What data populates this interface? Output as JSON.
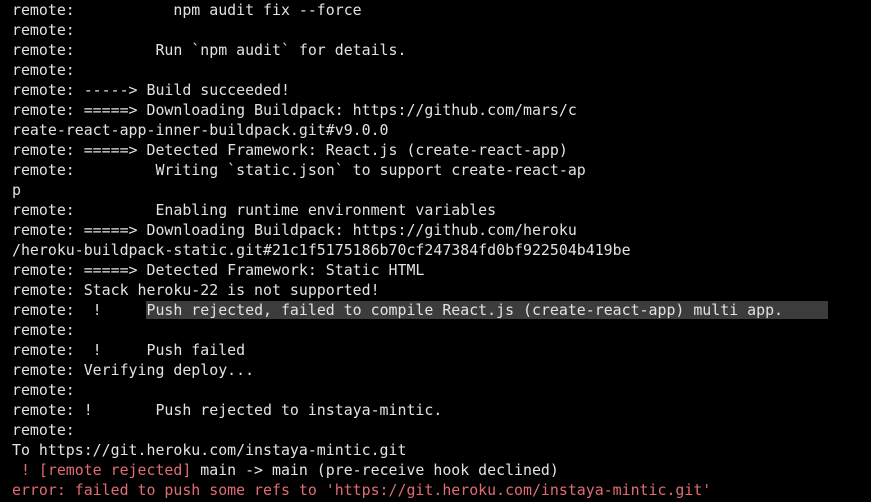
{
  "terminal": {
    "lines": [
      "remote:           npm audit fix --force",
      "remote:",
      "remote:         Run `npm audit` for details.",
      "remote:",
      "remote: -----> Build succeeded!",
      "remote: =====> Downloading Buildpack: https://github.com/mars/c",
      "reate-react-app-inner-buildpack.git#v9.0.0",
      "remote: =====> Detected Framework: React.js (create-react-app)",
      "remote:         Writing `static.json` to support create-react-ap",
      "p",
      "remote:         Enabling runtime environment variables",
      "remote: =====> Downloading Buildpack: https://github.com/heroku",
      "/heroku-buildpack-static.git#21c1f5175186b70cf247384fd0bf922504b419be",
      "remote: =====> Detected Framework: Static HTML",
      "remote: Stack heroku-22 is not supported!",
      "remote:  !     ",
      "remote:",
      "remote:  !     Push failed",
      "remote: Verifying deploy...",
      "remote:",
      "remote: !       Push rejected to instaya-mintic.",
      "remote:",
      "To https://git.heroku.com/instaya-mintic.git",
      " ! [remote rejected] ",
      "error: failed to push some refs to 'https://git.heroku.com/instaya-mintic.git'"
    ],
    "highlighted_text": "Push rejected, failed to compile React.js (create-react-app) multi app.     ",
    "rejected_suffix": "main -> main (pre-receive hook declined)"
  },
  "colors": {
    "background": "#000000",
    "foreground": "#e2e2e2",
    "error": "#e06c75",
    "highlight": "#3c3c3c"
  }
}
